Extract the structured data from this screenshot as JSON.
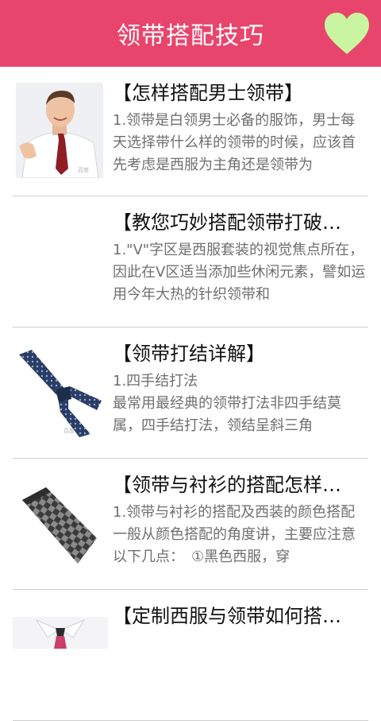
{
  "header": {
    "title": "领带搭配技巧",
    "accent": "#e8456d",
    "favorite_icon": "heart-icon",
    "favorite_color": "#c9f5a0"
  },
  "articles": [
    {
      "title": "【怎样搭配男士领带】",
      "desc": "1.领带是白领男士必备的服饰，男士每天选择带什么样的领带的时候，应该首先考虑是西服为主角还是领带为",
      "thumb": "man-in-shirt-and-tie"
    },
    {
      "title": "【教您巧妙搭配领带打破…",
      "desc": "1.\"V\"字区是西服套装的视觉焦点所在，因此在V区适当添加些休闲元素，譬如运用今年大热的针织领带和",
      "thumb": ""
    },
    {
      "title": "【领带打结详解】",
      "desc": "1.四手结打法\n最常用最经典的领带打法非四手结莫属，四手结打法，领结呈斜三角",
      "thumb": "blue-knotted-tie"
    },
    {
      "title": "【领带与衬衫的搭配怎样…",
      "desc": "1.领带与衬衫的搭配及西装的颜色搭配一般从颜色搭配的角度讲，主要应注意以下几点：　①黑色西服，穿",
      "thumb": "checkered-tie"
    },
    {
      "title": "【定制西服与领带如何搭…",
      "desc": "",
      "thumb": "shirt-collar-with-tie"
    }
  ]
}
